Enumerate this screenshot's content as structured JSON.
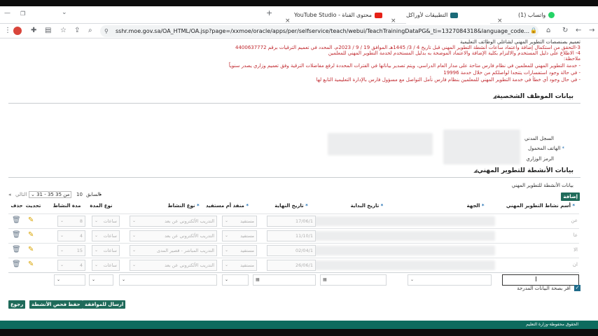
{
  "browser": {
    "tabs": [
      {
        "title": "(1) واتساب"
      },
      {
        "title": "التطبيقات لأوراكل"
      },
      {
        "title": "محتوى القناة - YouTube Studio"
      }
    ],
    "url": "sshr.moe.gov.sa/OA_HTML/OA.jsp?page=/xxmoe/oracle/apps/per/selfservice/teach/webui/TeachTrainingDataPG&_ti=1327084318&language_code..."
  },
  "notes": {
    "line1": "تعميم بصنصصات التطوير المهني لشاغلي الوظائف التعليمية",
    "line2": "3-التحقق من استكمال إضافة واعتماد ساعات أنشطة التطوير المهني قبل تاريخ 4 / 3/ 1445هـ الموافق 19 / 9 / 2023م، المحدد في تعميم الترقيات برقم 4400637772",
    "line3": "4- الاطلاع على دليل المستخدم والالتزام بكلية الإضافة والاعتماد الموضحة به بدليل المستخدم لخدمة التطوير المهني للمعلمين",
    "line4": "ملاحظة:",
    "line5": "- خدمة التطوير المهني للمعلمين في نظام فارس متاحة على مدار العام الدراسي، ويتم تصدير بياناتها في الفترات المحددة لرفع مفاضلات الترقية وفق تعميم وزاري يصدر سنوياً",
    "line6": "- في حالة وجود استفسارات يتنجدا لواصلكم من خلال خدمة 19996",
    "line7": "- في حال وجود أي خطأ في خدمة التطوير المهني للمعلمين بنظام فارس نأمل التواصل مع مسؤول فارس بالإدارة التعليمية التابع لها"
  },
  "personal": {
    "title": "بيانات الموظف الشخصية",
    "civil_record": "السجل المدني",
    "mobile": "الهاتف المحمول",
    "ministry_code": "الرمز الوزاري"
  },
  "activities": {
    "section_title": "بيانات الأنشطة للتطوير المهني",
    "sub_title": "بيانات الأنشطة للتطوير المهني",
    "add_button": "إضافة",
    "pager": {
      "previous": "السابق",
      "range_prev": "10",
      "range_current": "31 - 35 من 35",
      "next": "التالي"
    },
    "columns": {
      "name": "أسم نشاط التطوير المهني",
      "entity": "الجهة",
      "start": "تاريخ البداية",
      "end": "تاريخ النهاية",
      "status": "منفذ أم مستفيد",
      "type": "نوع النشاط",
      "duration_type": "نوع المدة",
      "duration": "مدة النشاط",
      "update": "تحديث",
      "delete": "حذف"
    },
    "rows": [
      {
        "name": "عن",
        "end": "17/06/1",
        "status": "مستفيد",
        "type": "التدريب الألكتروني عن بعد",
        "duration_type": "ساعات",
        "duration": "8"
      },
      {
        "name": "عا",
        "end": "11/10/1",
        "status": "مستفيد",
        "type": "التدريب الألكتروني عن بعد",
        "duration_type": "ساعات",
        "duration": "4"
      },
      {
        "name": "الا",
        "end": "02/04/1",
        "status": "مستفيد",
        "type": "التدريب المباشر - قصير المدى",
        "duration_type": "ساعات",
        "duration": "15"
      },
      {
        "name": "ان",
        "end": "26/06/1",
        "status": "مستفيد",
        "type": "التدريب الألكتروني عن بعد",
        "duration_type": "ساعات",
        "duration": "4"
      }
    ],
    "confirm_label": "أقر بصحة البيانات المدرجة"
  },
  "buttons": {
    "submit": "ارسال للموافقة",
    "save": "حفظ",
    "check": "فحص الأنشطة",
    "back": "رجوع"
  },
  "footer": {
    "copyright": "الحقوق محفوظة-وزارة التعليم"
  },
  "colors": {
    "accent": "#1f6b5a",
    "notice": "#c0282e",
    "statusbar": "#0e6b5e"
  }
}
